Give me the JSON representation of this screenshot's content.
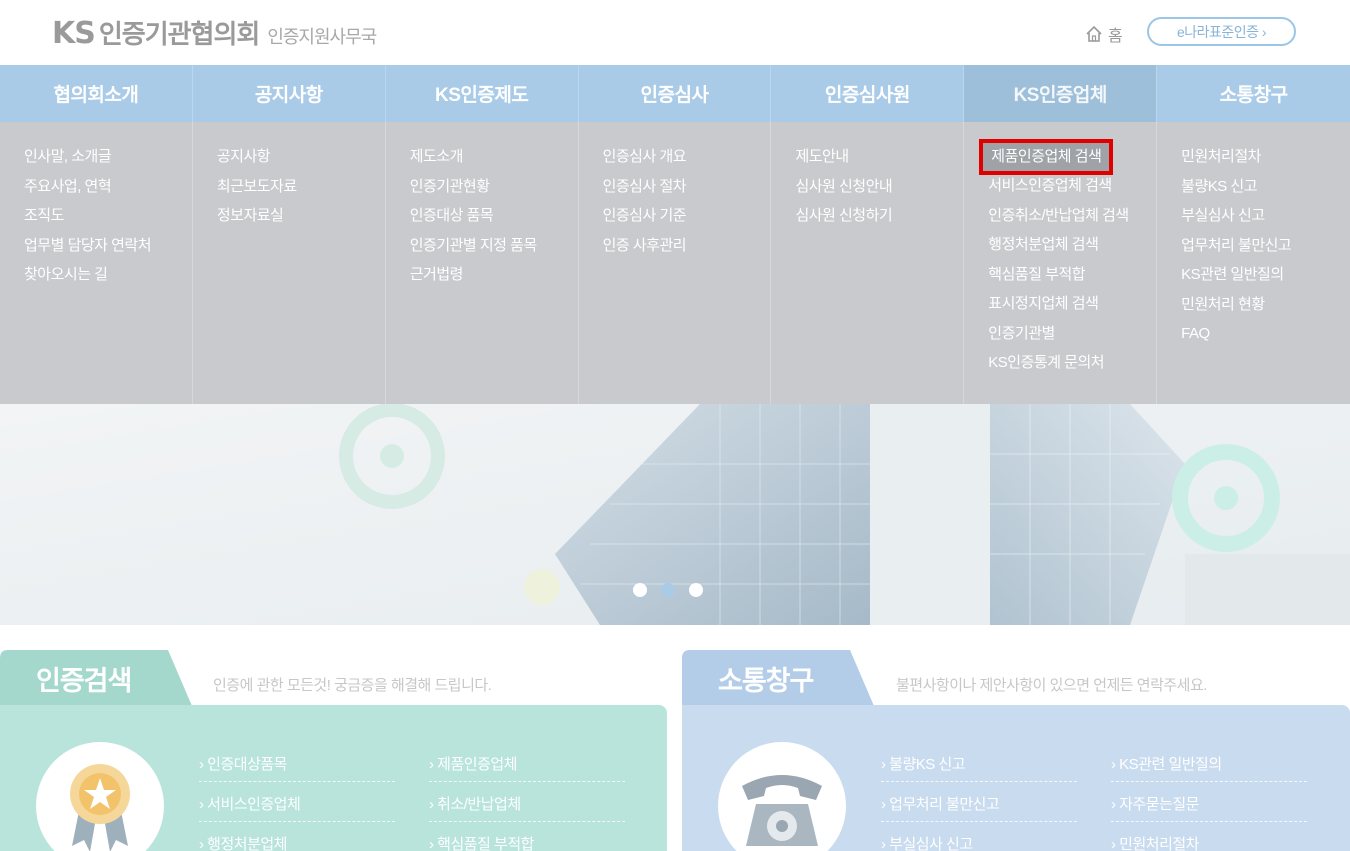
{
  "header": {
    "logo_ks": "KS",
    "logo_name": "인증기관협의회",
    "logo_sub": "인증지원사무국",
    "home_label": "홈",
    "enara_label": "e나라표준인증 ›"
  },
  "gnb": {
    "items": [
      {
        "label": "협의회소개"
      },
      {
        "label": "공지사항"
      },
      {
        "label": "KS인증제도"
      },
      {
        "label": "인증심사"
      },
      {
        "label": "인증심사원"
      },
      {
        "label": "KS인증업체"
      },
      {
        "label": "소통창구"
      }
    ],
    "active_index": 5
  },
  "mega": {
    "columns": [
      {
        "items": [
          "인사말, 소개글",
          "주요사업, 연혁",
          "조직도",
          "업무별 담당자 연락처",
          "찾아오시는 길"
        ]
      },
      {
        "items": [
          "공지사항",
          "최근보도자료",
          "정보자료실"
        ]
      },
      {
        "items": [
          "제도소개",
          "인증기관현황",
          "인증대상 품목",
          "인증기관별 지정 품목",
          "근거법령"
        ]
      },
      {
        "items": [
          "인증심사 개요",
          "인증심사 절차",
          "인증심사 기준",
          "인증 사후관리"
        ]
      },
      {
        "items": [
          "제도안내",
          "심사원 신청안내",
          "심사원 신청하기"
        ]
      },
      {
        "items": [
          "제품인증업체 검색",
          "서비스인증업체 검색",
          "인증취소/반납업체 검색",
          "행정처분업체 검색",
          "핵심품질 부적합",
          "표시정지업체 검색",
          "인증기관별",
          "KS인증통계 문의처"
        ]
      },
      {
        "items": [
          "민원처리절차",
          "불량KS 신고",
          "부실심사 신고",
          "업무처리 불만신고",
          "KS관련 일반질의",
          "민원처리 현황",
          "FAQ"
        ]
      }
    ],
    "highlighted": "제품인증업체 검색"
  },
  "banner": {
    "slides": 3,
    "active_slide": 1
  },
  "search_panel": {
    "title": "인증검색",
    "desc": "인증에 관한 모든것! 궁금증을 해결해 드립니다.",
    "links": [
      "› 인증대상품목",
      "› 제품인증업체",
      "› 서비스인증업체",
      "› 취소/반납업체",
      "› 행정처분업체",
      "› 핵심품질 부적합"
    ]
  },
  "comm_panel": {
    "title": "소통창구",
    "desc": "불편사항이나 제안사항이 있으면 언제든 연락주세요.",
    "links": [
      "› 불량KS 신고",
      "› KS관련 일반질의",
      "› 업무처리 불만신고",
      "› 자주묻는질문",
      "› 부실심사 신고",
      "› 민원처리절차"
    ]
  },
  "colors": {
    "gnb_bg": "#a9cbe8",
    "mega_bg": "#c8cacd",
    "highlight_border": "#e00000",
    "search_panel_bg": "#b8e4dc",
    "search_tab_bg": "#a5d8cd",
    "comm_panel_bg": "#c9dbef",
    "comm_tab_bg": "#b3cde8"
  },
  "icons": {
    "home": "home-icon",
    "award": "award-ribbon-icon",
    "phone": "telephone-icon"
  }
}
